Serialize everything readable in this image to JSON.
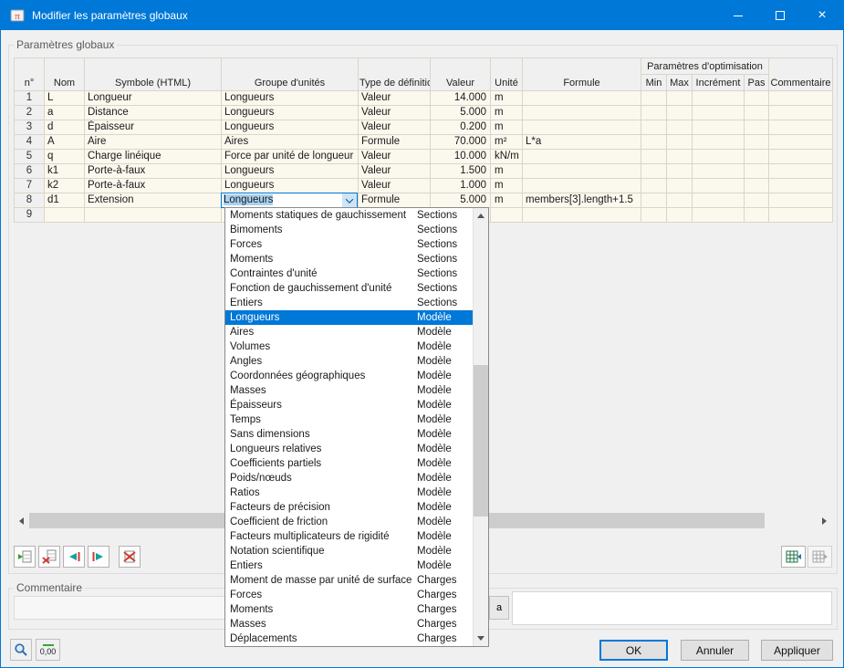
{
  "window": {
    "title": "Modifier les paramètres globaux"
  },
  "group_parameters": {
    "title": "Paramètres globaux"
  },
  "table": {
    "optimization_header": "Paramètres d'optimisation",
    "columns": {
      "num": "n°",
      "nom": "Nom",
      "symbole": "Symbole (HTML)",
      "groupe": "Groupe d'unités",
      "type": "Type de définition",
      "valeur": "Valeur",
      "unite": "Unité",
      "formule": "Formule",
      "min": "Min",
      "max": "Max",
      "increment": "Incrément",
      "pas": "Pas",
      "commentaire": "Commentaire"
    },
    "rows": [
      {
        "n": "1",
        "nom": "L",
        "symbole": "Longueur",
        "groupe": "Longueurs",
        "type": "Valeur",
        "valeur": "14.000",
        "unite": "m",
        "formule": ""
      },
      {
        "n": "2",
        "nom": "a",
        "symbole": "Distance",
        "groupe": "Longueurs",
        "type": "Valeur",
        "valeur": "5.000",
        "unite": "m",
        "formule": ""
      },
      {
        "n": "3",
        "nom": "d",
        "symbole": "Épaisseur",
        "groupe": "Longueurs",
        "type": "Valeur",
        "valeur": "0.200",
        "unite": "m",
        "formule": ""
      },
      {
        "n": "4",
        "nom": "A",
        "symbole": "Aire",
        "groupe": "Aires",
        "type": "Formule",
        "valeur": "70.000",
        "unite": "m²",
        "formule": "L*a"
      },
      {
        "n": "5",
        "nom": "q",
        "symbole": "Charge linéique",
        "groupe": "Force par unité de longueur",
        "type": "Valeur",
        "valeur": "10.000",
        "unite": "kN/m",
        "formule": ""
      },
      {
        "n": "6",
        "nom": "k1",
        "symbole": "Porte-à-faux",
        "groupe": "Longueurs",
        "type": "Valeur",
        "valeur": "1.500",
        "unite": "m",
        "formule": ""
      },
      {
        "n": "7",
        "nom": "k2",
        "symbole": "Porte-à-faux",
        "groupe": "Longueurs",
        "type": "Valeur",
        "valeur": "1.000",
        "unite": "m",
        "formule": ""
      },
      {
        "n": "8",
        "nom": "d1",
        "symbole": "Extension",
        "groupe": "Longueurs",
        "type": "Formule",
        "valeur": "5.000",
        "unite": "m",
        "formule": "members[3].length+1.5",
        "combo_open": true
      },
      {
        "n": "9",
        "nom": "",
        "symbole": "",
        "groupe": "",
        "type": "",
        "valeur": "",
        "unite": "",
        "formule": ""
      }
    ]
  },
  "combobox": {
    "value": "Longueurs"
  },
  "dropdown": {
    "items": [
      {
        "label": "Moments statiques de gauchissement",
        "category": "Sections"
      },
      {
        "label": "Bimoments",
        "category": "Sections"
      },
      {
        "label": "Forces",
        "category": "Sections"
      },
      {
        "label": "Moments",
        "category": "Sections"
      },
      {
        "label": "Contraintes d'unité",
        "category": "Sections"
      },
      {
        "label": "Fonction de gauchissement d'unité",
        "category": "Sections"
      },
      {
        "label": "Entiers",
        "category": "Sections"
      },
      {
        "label": "Longueurs",
        "category": "Modèle",
        "selected": true
      },
      {
        "label": "Aires",
        "category": "Modèle"
      },
      {
        "label": "Volumes",
        "category": "Modèle"
      },
      {
        "label": "Angles",
        "category": "Modèle"
      },
      {
        "label": "Coordonnées géographiques",
        "category": "Modèle"
      },
      {
        "label": "Masses",
        "category": "Modèle"
      },
      {
        "label": "Épaisseurs",
        "category": "Modèle"
      },
      {
        "label": "Temps",
        "category": "Modèle"
      },
      {
        "label": "Sans dimensions",
        "category": "Modèle"
      },
      {
        "label": "Longueurs relatives",
        "category": "Modèle"
      },
      {
        "label": "Coefficients partiels",
        "category": "Modèle"
      },
      {
        "label": "Poids/nœuds",
        "category": "Modèle"
      },
      {
        "label": "Ratios",
        "category": "Modèle"
      },
      {
        "label": "Facteurs de précision",
        "category": "Modèle"
      },
      {
        "label": "Coefficient de friction",
        "category": "Modèle"
      },
      {
        "label": "Facteurs multiplicateurs de rigidité",
        "category": "Modèle"
      },
      {
        "label": "Notation scientifique",
        "category": "Modèle"
      },
      {
        "label": "Entiers",
        "category": "Modèle"
      },
      {
        "label": "Moment de masse par unité de surface",
        "category": "Charges"
      },
      {
        "label": "Forces",
        "category": "Charges"
      },
      {
        "label": "Moments",
        "category": "Charges"
      },
      {
        "label": "Masses",
        "category": "Charges"
      },
      {
        "label": "Déplacements",
        "category": "Charges"
      }
    ]
  },
  "comment_group": {
    "label": "Commentaire",
    "value": "",
    "expand_button": "a"
  },
  "footer": {
    "decimal_button": "0,00",
    "ok": "OK",
    "cancel": "Annuler",
    "apply": "Appliquer"
  }
}
